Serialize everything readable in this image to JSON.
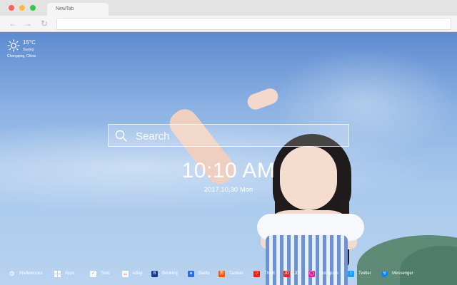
{
  "browser": {
    "tab_title": "NewTab"
  },
  "weather": {
    "temperature": "15°C",
    "condition": "Sunny",
    "location": "Chongqing, China"
  },
  "search": {
    "placeholder": "Search"
  },
  "clock": {
    "time": "10:10 AM",
    "date": "2017.10.30 Mon"
  },
  "bottom_bar": [
    {
      "label": "Preferences",
      "icon": "gear-icon",
      "color": "#ffffff"
    },
    {
      "label": "Apps",
      "icon": "grid-icon",
      "color": "#ffffff"
    },
    {
      "label": "Todo",
      "icon": "check-icon",
      "color": "#ffffff"
    },
    {
      "label": "eBay",
      "icon": "ebay-icon",
      "color": "#ffffff"
    },
    {
      "label": "Booking",
      "icon": "booking-icon",
      "color": "#1b3a8c"
    },
    {
      "label": "Baidu",
      "icon": "baidu-icon",
      "color": "#2f6fe0"
    },
    {
      "label": "Taobao",
      "icon": "taobao-icon",
      "color": "#ff5000"
    },
    {
      "label": "Tmall",
      "icon": "tmall-icon",
      "color": "#e2231a"
    },
    {
      "label": "JD",
      "icon": "jd-icon",
      "color": "#e1251b"
    },
    {
      "label": "Instagram",
      "icon": "instagram-icon",
      "color": "#d6249f"
    },
    {
      "label": "Twitter",
      "icon": "twitter-icon",
      "color": "#1da1f2"
    },
    {
      "label": "Messenger",
      "icon": "messenger-icon",
      "color": "#0084ff"
    }
  ]
}
